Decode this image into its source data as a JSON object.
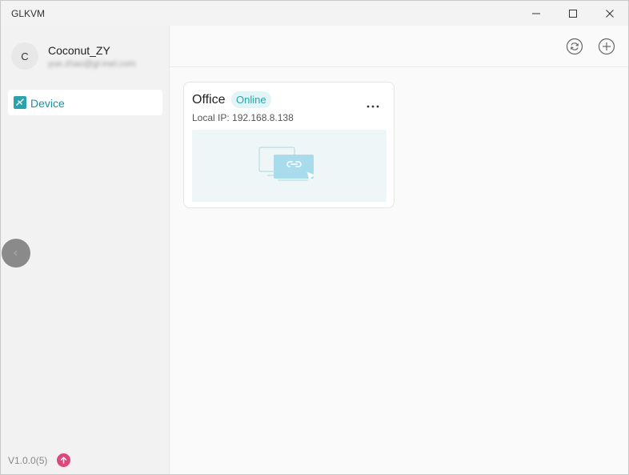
{
  "window": {
    "title": "GLKVM"
  },
  "colors": {
    "accent": "#2aa3ad",
    "update": "#e0457b",
    "sidebar_bg": "#f2f2f2"
  },
  "user": {
    "avatar_letter": "C",
    "name": "Coconut_ZY",
    "email": "yue.zhao@gl-inet.com"
  },
  "sidebar": {
    "items": [
      {
        "label": "Device",
        "icon": "device-icon",
        "active": true
      }
    ],
    "version": "V1.0.0(5)"
  },
  "toolbar": {
    "refresh_icon": "refresh-icon",
    "add_icon": "add-icon"
  },
  "devices": [
    {
      "name": "Office",
      "status": "Online",
      "local_ip": "Local IP: 192.168.8.138"
    }
  ]
}
